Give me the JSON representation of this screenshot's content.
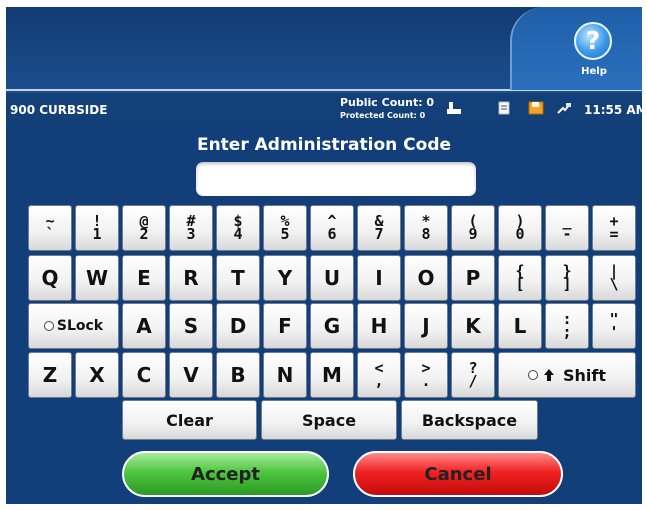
{
  "help": {
    "label": "Help",
    "icon": "?"
  },
  "status": {
    "station": "900 CURBSIDE",
    "public_count": "Public Count: 0",
    "protected_count": "Protected Count: 0",
    "time": "11:55 AM"
  },
  "prompt": {
    "title": "Enter Administration Code",
    "input_value": ""
  },
  "keyboard": {
    "row1": [
      {
        "top": "~",
        "bot": "`"
      },
      {
        "top": "!",
        "bot": "1"
      },
      {
        "top": "@",
        "bot": "2"
      },
      {
        "top": "#",
        "bot": "3"
      },
      {
        "top": "$",
        "bot": "4"
      },
      {
        "top": "%",
        "bot": "5"
      },
      {
        "top": "^",
        "bot": "6"
      },
      {
        "top": "&",
        "bot": "7"
      },
      {
        "top": "*",
        "bot": "8"
      },
      {
        "top": "(",
        "bot": "9"
      },
      {
        "top": ")",
        "bot": "0"
      },
      {
        "top": "_",
        "bot": "-"
      },
      {
        "top": "+",
        "bot": "="
      }
    ],
    "row2": [
      {
        "label": "Q"
      },
      {
        "label": "W"
      },
      {
        "label": "E"
      },
      {
        "label": "R"
      },
      {
        "label": "T"
      },
      {
        "label": "Y"
      },
      {
        "label": "U"
      },
      {
        "label": "I"
      },
      {
        "label": "O"
      },
      {
        "label": "P"
      },
      {
        "top": "{",
        "bot": "["
      },
      {
        "top": "}",
        "bot": "]"
      },
      {
        "top": "|",
        "bot": "\\"
      }
    ],
    "slock_label": "SLock",
    "row3": [
      {
        "label": "A"
      },
      {
        "label": "S"
      },
      {
        "label": "D"
      },
      {
        "label": "F"
      },
      {
        "label": "G"
      },
      {
        "label": "H"
      },
      {
        "label": "J"
      },
      {
        "label": "K"
      },
      {
        "label": "L"
      },
      {
        "top": ":",
        "bot": ";"
      },
      {
        "top": "\"",
        "bot": "'"
      }
    ],
    "row4": [
      {
        "label": "Z"
      },
      {
        "label": "X"
      },
      {
        "label": "C"
      },
      {
        "label": "V"
      },
      {
        "label": "B"
      },
      {
        "label": "N"
      },
      {
        "label": "M"
      },
      {
        "top": "<",
        "bot": ","
      },
      {
        "top": ">",
        "bot": "."
      },
      {
        "top": "?",
        "bot": "/"
      }
    ],
    "shift_label": "Shift",
    "clear_label": "Clear",
    "space_label": "Space",
    "backspace_label": "Backspace"
  },
  "actions": {
    "accept": "Accept",
    "cancel": "Cancel"
  }
}
